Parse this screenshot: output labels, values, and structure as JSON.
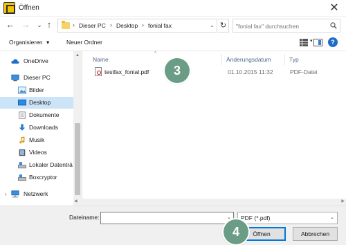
{
  "window": {
    "title": "Öffnen",
    "close_glyph": "✕"
  },
  "address": {
    "back_glyph": "←",
    "forward_glyph": "→",
    "recent_glyph": "⌄",
    "up_glyph": "↑",
    "breadcrumbs": [
      "Dieser PC",
      "Desktop",
      "fonial fax"
    ],
    "separator": "›",
    "dropdown_glyph": "⌄",
    "refresh_glyph": "↻",
    "search_placeholder": "\"fonial fax\" durchsuchen"
  },
  "toolbar": {
    "organize_label": "Organisieren",
    "organize_arrow": "▾",
    "new_folder_label": "Neuer Ordner",
    "view_arrow": "▾",
    "help_label": "?"
  },
  "nav": {
    "items": [
      {
        "label": "OneDrive",
        "icon": "cloud-icon"
      },
      {
        "label": "Dieser PC",
        "icon": "computer-icon"
      },
      {
        "label": "Bilder",
        "icon": "pictures-folder-icon"
      },
      {
        "label": "Desktop",
        "icon": "desktop-folder-icon",
        "selected": true
      },
      {
        "label": "Dokumente",
        "icon": "documents-folder-icon"
      },
      {
        "label": "Downloads",
        "icon": "downloads-folder-icon"
      },
      {
        "label": "Musik",
        "icon": "music-folder-icon"
      },
      {
        "label": "Videos",
        "icon": "videos-folder-icon"
      },
      {
        "label": "Lokaler Datenträ",
        "icon": "drive-icon"
      },
      {
        "label": "Boxcryptor",
        "icon": "boxcryptor-icon"
      },
      {
        "label": "Netzwerk",
        "icon": "network-icon"
      }
    ],
    "expand_glyph": "›"
  },
  "files": {
    "columns": [
      "Name",
      "Änderungsdatum",
      "Typ"
    ],
    "sort_glyph": "^",
    "rows": [
      {
        "name": "testfax_fonial.pdf",
        "date": "01.10.2015 11:32",
        "type": "PDF-Datei",
        "icon": "pdf-file-icon"
      }
    ]
  },
  "scroll": {
    "up": "▲",
    "down": "▼",
    "left": "◀",
    "right": "▶"
  },
  "badges": {
    "step3": "3",
    "step4": "4",
    "color": "#6b9d86"
  },
  "footer": {
    "filename_label": "Dateiname:",
    "filename_value": "",
    "filename_dropdown_glyph": "⌄",
    "filetype_value": "PDF (*.pdf)",
    "filetype_dropdown_glyph": "⌄",
    "open_label": "Öffnen",
    "cancel_label": "Abbrechen"
  },
  "colors": {
    "accent": "#0078d7",
    "selection": "#cce4f7",
    "app_icon": "#f2c300"
  }
}
